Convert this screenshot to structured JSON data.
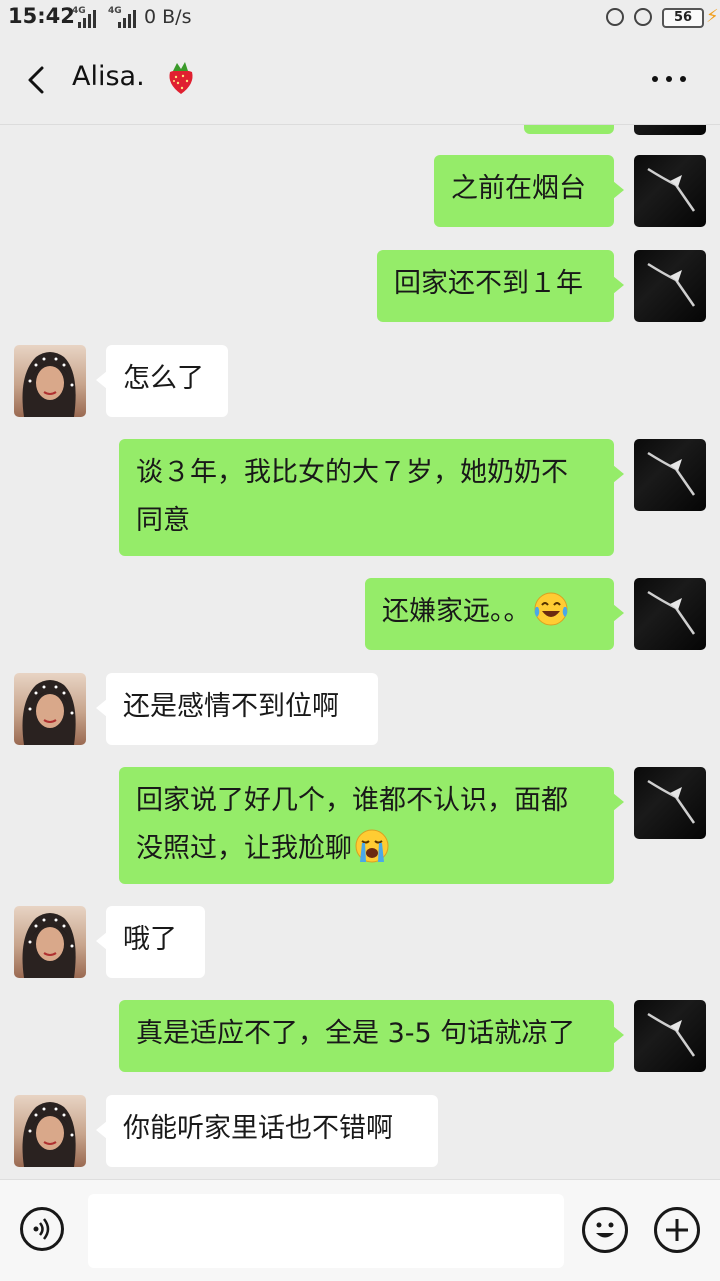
{
  "status_bar": {
    "time": "15:42",
    "signal1": "4G",
    "signal2": "4G",
    "network_speed": "0 B/s",
    "battery": "56"
  },
  "header": {
    "title": "Alisa.",
    "title_emoji": "strawberry",
    "back_icon": "back-chevron",
    "more_icon": "more-dots"
  },
  "messages": [
    {
      "from": "me",
      "text": "之前在烟台"
    },
    {
      "from": "me",
      "text": "回家还不到１年"
    },
    {
      "from": "her",
      "text": "怎么了"
    },
    {
      "from": "me",
      "line1": "谈３年，我比女的大７岁，她奶奶不",
      "line2": "同意"
    },
    {
      "from": "me",
      "text": "还嫌家远。。",
      "emoji": "tears-of-joy"
    },
    {
      "from": "her",
      "text": "还是感情不到位啊"
    },
    {
      "from": "me",
      "line1": "回家说了好几个，谁都不认识，面都",
      "line2": "没照过，让我尬聊",
      "emoji": "loudly-crying"
    },
    {
      "from": "her",
      "text": "哦了"
    },
    {
      "from": "me",
      "text": "真是适应不了，全是 3-5 句话就凉了"
    },
    {
      "from": "her",
      "text": "你能听家里话也不错啊"
    }
  ],
  "bottom_bar": {
    "voice_icon": "voice",
    "emoji_icon": "smiley",
    "plus_icon": "plus",
    "input_value": ""
  },
  "colors": {
    "background": "#ededed",
    "my_bubble": "#95ec69",
    "her_bubble": "#ffffff",
    "bottom_bar": "#f7f7f7"
  }
}
